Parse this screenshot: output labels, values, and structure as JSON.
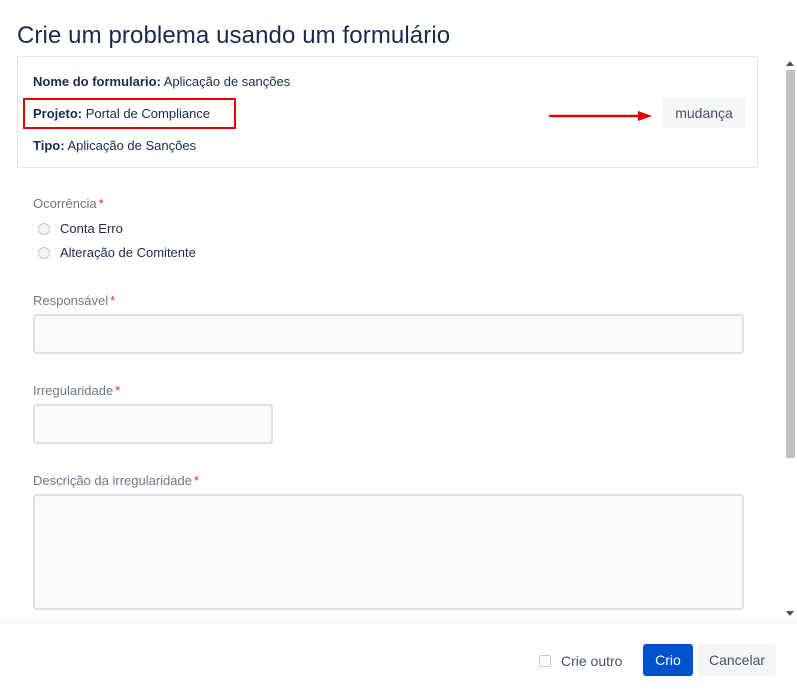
{
  "dialog": {
    "title": "Crie um problema usando um formulário"
  },
  "info": {
    "form_name_label": "Nome do formulario:",
    "form_name_value": "Aplicação de sanções",
    "project_label": "Projeto:",
    "project_value": "Portal de Compliance",
    "type_label": "Tipo:",
    "type_value": "Aplicação de Sanções",
    "change_button": "mudança"
  },
  "form": {
    "occurrence": {
      "label": "Ocorrência",
      "required_marker": "*",
      "options": [
        "Conta Erro",
        "Alteração de Comitente"
      ]
    },
    "responsible": {
      "label": "Responsável",
      "required_marker": "*",
      "value": ""
    },
    "irregularity": {
      "label": "Irregularidade",
      "required_marker": "*",
      "value": ""
    },
    "description": {
      "label": "Descrição da irregularidade",
      "required_marker": "*",
      "value": ""
    }
  },
  "footer": {
    "create_another_label": "Crie outro",
    "create_button": "Crio",
    "cancel_button": "Cancelar"
  },
  "colors": {
    "primary": "#0052cc",
    "annotation_red": "#e60000",
    "required": "#de350b",
    "text": "#172b4d"
  }
}
